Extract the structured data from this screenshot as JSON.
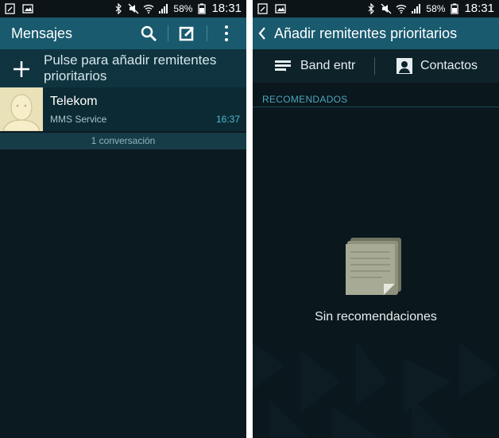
{
  "status": {
    "battery": "58%",
    "time": "18:31"
  },
  "left": {
    "title": "Mensajes",
    "add_text": "Pulse para añadir remitentes prioritarios",
    "thread": {
      "name": "Telekom",
      "snippet": "MMS Service",
      "time": "16:37"
    },
    "conversation_count": "1 conversación"
  },
  "right": {
    "title": "Añadir remitentes prioritarios",
    "tabs": [
      {
        "label": "Band entr",
        "icon": "inbox-icon"
      },
      {
        "label": "Contactos",
        "icon": "contact-icon"
      }
    ],
    "section": "RECOMENDADOS",
    "empty": "Sin recomendaciones"
  },
  "colors": {
    "accent": "#195a6e",
    "time_blue": "#4fb7d3",
    "background": "#0b1a20"
  }
}
